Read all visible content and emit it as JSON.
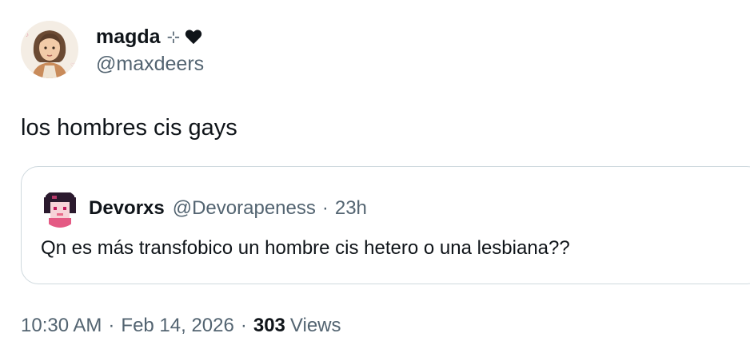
{
  "author": {
    "display_name": "magda",
    "name_emoji": "⊹",
    "handle": "@maxdeers",
    "avatar_icon": "illustrated-portrait-avatar",
    "heart_icon": "black-heart-icon"
  },
  "tweet": {
    "text": "los hombres cis gays"
  },
  "quoted_tweet": {
    "display_name": "Devorxs",
    "handle": "@Devorapeness",
    "separator": "·",
    "time": "23h",
    "text": "Qn es más transfobico un hombre cis hetero o una lesbiana??",
    "avatar_icon": "pixel-art-avatar"
  },
  "meta": {
    "time": "10:30 AM",
    "sep1": "·",
    "date": "Feb 14, 2026",
    "sep2": "·",
    "views_count": "303",
    "views_label": "Views"
  },
  "colors": {
    "text_primary": "#0f1419",
    "text_secondary": "#536471",
    "border": "#cfd9de"
  }
}
